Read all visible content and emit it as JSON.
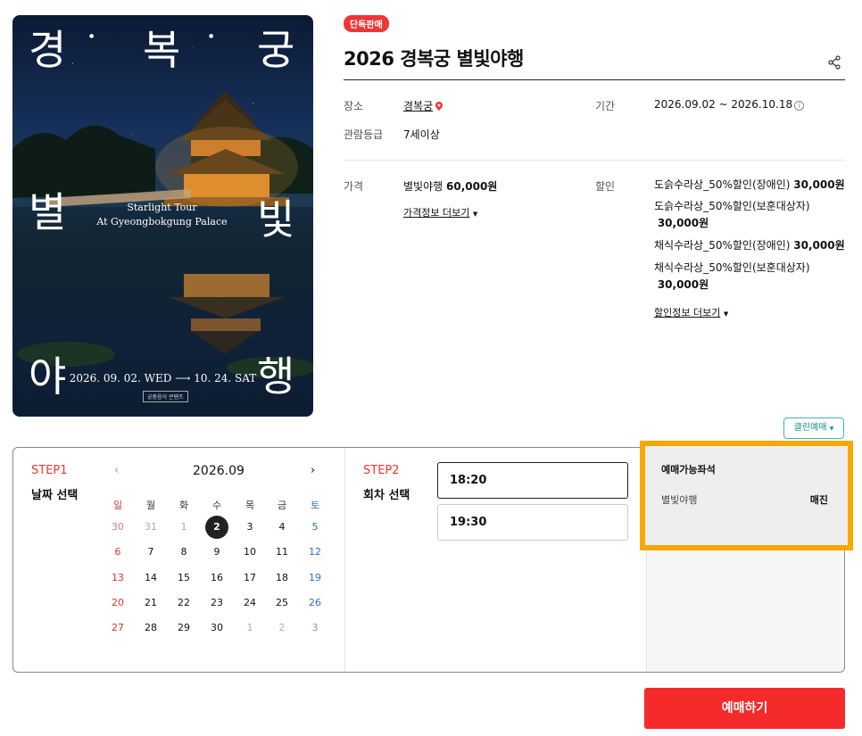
{
  "poster": {
    "char1": "경",
    "char2": "복",
    "char3": "궁",
    "char4": "별",
    "char5": "빛",
    "char6": "야",
    "char7": "행",
    "subtitle_line1": "Starlight Tour",
    "subtitle_line2": "At Gyeongbokgung Palace",
    "dates": "2026. 09. 02. WED ⟶ 10. 24. SAT",
    "credit": "궁중음식 콘텐츠"
  },
  "product": {
    "badge": "단독판매",
    "title": "2026 경복궁 별빛야행",
    "venue_label": "장소",
    "venue": "경복궁",
    "period_label": "기간",
    "period": "2026.09.02 ~ 2026.10.18",
    "rating_label": "관람등급",
    "rating": "7세이상",
    "price_label": "가격",
    "price_name": "별빛야행",
    "price_value": "60,000원",
    "price_more": "가격정보 더보기",
    "discount_label": "할인",
    "discounts": [
      {
        "name": "도슭수라상_50%할인(장애인)",
        "price": "30,000원"
      },
      {
        "name": "도슭수라상_50%할인(보훈대상자)",
        "price": "30,000원"
      },
      {
        "name": "채식수라상_50%할인(장애인)",
        "price": "30,000원"
      },
      {
        "name": "채식수라상_50%할인(보훈대상자)",
        "price": "30,000원"
      }
    ],
    "discount_more": "할인정보 더보기"
  },
  "clean_button": "클린예매",
  "step1": {
    "num": "STEP1",
    "name": "날짜 선택"
  },
  "step2": {
    "num": "STEP2",
    "name": "회차 선택"
  },
  "calendar": {
    "month": "2026.09",
    "prev": "‹",
    "next": "›",
    "weekdays": [
      "일",
      "월",
      "화",
      "수",
      "목",
      "금",
      "토"
    ],
    "weeks": [
      [
        "30",
        "31",
        "1",
        "2",
        "3",
        "4",
        "5"
      ],
      [
        "6",
        "7",
        "8",
        "9",
        "10",
        "11",
        "12"
      ],
      [
        "13",
        "14",
        "15",
        "16",
        "17",
        "18",
        "19"
      ],
      [
        "20",
        "21",
        "22",
        "23",
        "24",
        "25",
        "26"
      ],
      [
        "27",
        "28",
        "29",
        "30",
        "1",
        "2",
        "3"
      ]
    ],
    "selected": "2"
  },
  "times": [
    "18:20",
    "19:30"
  ],
  "seats": {
    "title": "예매가능좌석",
    "name": "별빛야행",
    "status": "매진"
  },
  "reserve_button": "예매하기",
  "colors": {
    "accent": "#f52a2a",
    "highlight": "#f5a800",
    "teal": "#3fb3c0"
  }
}
